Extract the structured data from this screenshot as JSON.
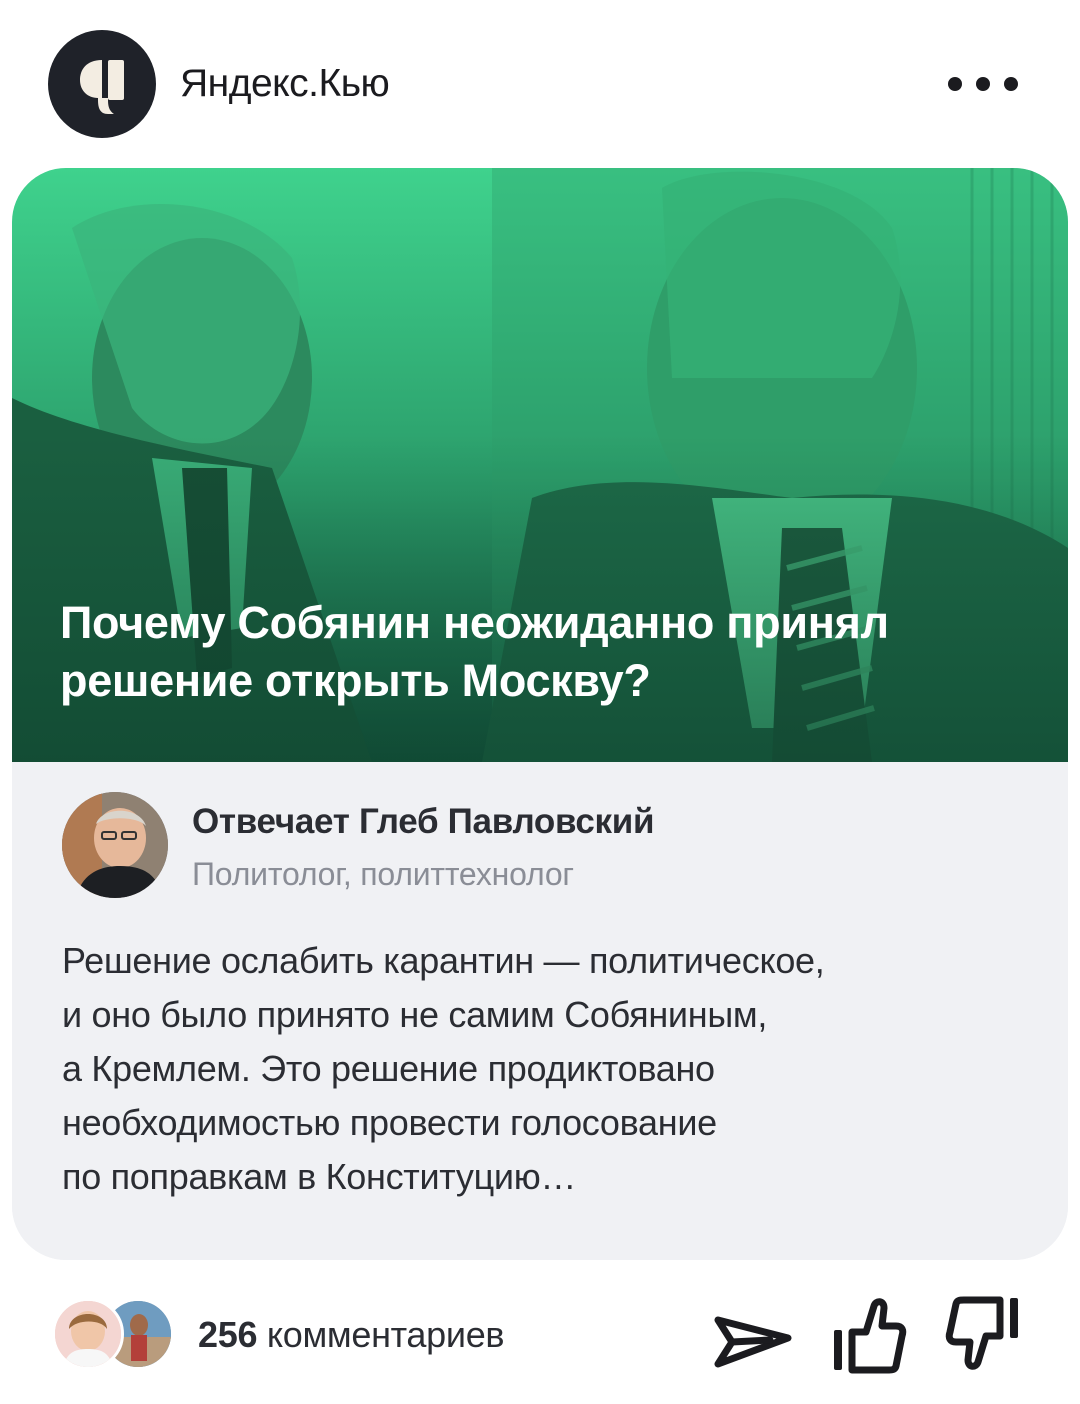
{
  "header": {
    "brand": "Яндекс.Кью",
    "logo_icon": "q-logo-icon",
    "menu_icon": "more-dots-icon"
  },
  "post": {
    "question": "Почему Собянин неожиданно принял решение открыть Москву?",
    "author": {
      "name": "Отвечает Глеб Павловский",
      "role": "Политолог, политтехнолог"
    },
    "answer": "Решение ослабить карантин — политическое,\nи оно было принято не самим Собяниным,\nа Кремлем. Это решение продиктовано\nнеобходимостью провести голосование\nпо поправкам в Конституцию…"
  },
  "footer": {
    "comments_count": "256",
    "comments_label": "комментариев",
    "actions": [
      "share-icon",
      "like-icon",
      "dislike-icon"
    ]
  },
  "colors": {
    "accent_green": "#2f9d6b",
    "hero_overlay_top": "#3ccf8a",
    "hero_overlay_bottom": "#14573f",
    "card_bg": "#f0f1f4"
  }
}
